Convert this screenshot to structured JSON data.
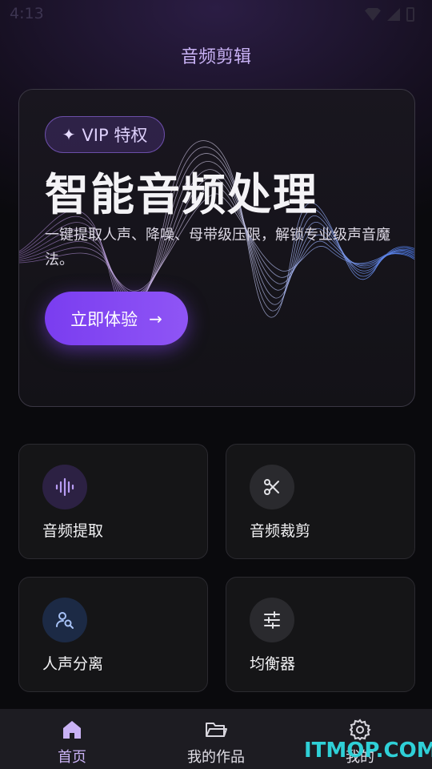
{
  "status_bar": {
    "time": "4:13"
  },
  "app_title": "音频剪辑",
  "hero": {
    "badge": "VIP 特权",
    "title": "智能音频处理",
    "description": "一键提取人声、降噪、母带级压限，解锁专业级声音魔法。",
    "cta_label": "立即体验"
  },
  "features": [
    {
      "label": "音频提取",
      "icon": "audio-wave-icon",
      "accent": "#a98cf0"
    },
    {
      "label": "音频裁剪",
      "icon": "scissors-icon",
      "accent": "#d8d8dc"
    },
    {
      "label": "人声分离",
      "icon": "person-search-icon",
      "accent": "#90b4f6"
    },
    {
      "label": "均衡器",
      "icon": "equalizer-icon",
      "accent": "#d8d8dc"
    }
  ],
  "nav": {
    "items": [
      {
        "label": "首页",
        "icon": "home-icon",
        "active": true
      },
      {
        "label": "我的作品",
        "icon": "folder-icon",
        "active": false
      },
      {
        "label": "我的",
        "icon": "gear-icon",
        "active": false
      }
    ]
  },
  "colors": {
    "accent": "#7a3df0",
    "accent_light": "#c9b2f5",
    "background": "#0a0a0d"
  },
  "watermark": "ITMOP.COM"
}
